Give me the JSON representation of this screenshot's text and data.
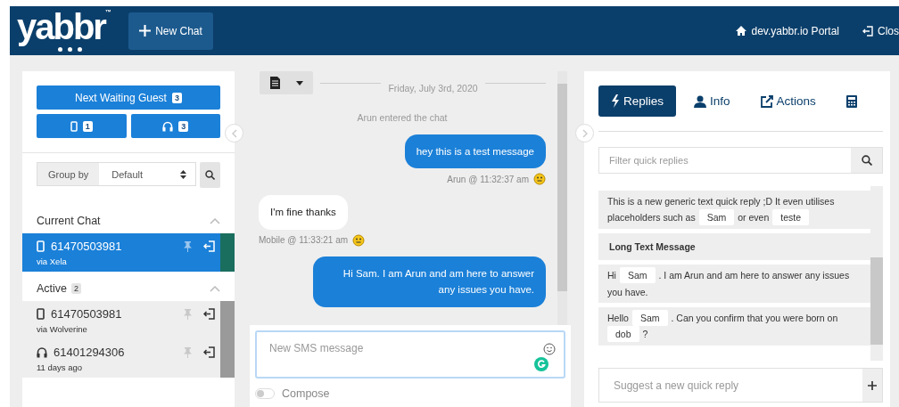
{
  "header": {
    "logo": "yabbr",
    "logo_mark": "™",
    "new_chat": "New Chat",
    "portal": "dev.yabbr.io Portal",
    "close": "Clos"
  },
  "queue": {
    "next_button": "Next Waiting Guest",
    "next_count": "3",
    "mobile_count": "1",
    "voice_count": "3"
  },
  "group_by": {
    "label": "Group by",
    "value": "Default"
  },
  "sections": [
    {
      "title": "Current Chat",
      "expanded": true,
      "items": [
        {
          "kind": "mobile",
          "number": "61470503981",
          "sub": "via Xela",
          "selected": true,
          "color": "#1a6e5e"
        }
      ]
    },
    {
      "title": "Active",
      "count": "2",
      "expanded": true,
      "items": [
        {
          "kind": "mobile",
          "number": "61470503981",
          "sub": "via Wolverine",
          "selected": false,
          "color": "#9a9a9a"
        },
        {
          "kind": "voice",
          "number": "61401294306",
          "sub": "11 days ago",
          "selected": false,
          "color": "#9a9a9a"
        }
      ]
    }
  ],
  "chat": {
    "date": "Friday, July 3rd, 2020",
    "messages": [
      {
        "kind": "system",
        "text": "Arun entered the chat"
      },
      {
        "kind": "agent",
        "text": "hey this is a test message",
        "meta": "Arun @ 11:32:37 am"
      },
      {
        "kind": "guest",
        "text": "I'm fine thanks",
        "meta": "Mobile @ 11:33:21 am"
      },
      {
        "kind": "agent",
        "text": "Hi Sam. I am Arun and am here to answer any issues you have."
      }
    ],
    "composer": {
      "placeholder": "New SMS message"
    },
    "compose": {
      "label": "Compose",
      "on": false
    }
  },
  "tabs": [
    {
      "kind": "replies",
      "label": "Replies",
      "selected": true
    },
    {
      "kind": "info",
      "label": "Info",
      "selected": false
    },
    {
      "kind": "actions",
      "label": "Actions",
      "selected": false
    },
    {
      "kind": "calc",
      "selected": false
    }
  ],
  "filter": {
    "placeholder": "Filter quick replies"
  },
  "quick_replies": [
    {
      "kind": "body",
      "parts": [
        {
          "kind": "text",
          "text": "This is a new generic text quick reply ;D It even utilises"
        },
        {
          "kind": "text",
          "text": "placeholders such as"
        },
        {
          "kind": "chip",
          "text": "Sam"
        },
        {
          "kind": "text",
          "text": "or even"
        },
        {
          "kind": "chip",
          "text": "teste"
        }
      ]
    },
    {
      "kind": "title",
      "parts": [
        {
          "kind": "text",
          "text": "Long Text Message"
        }
      ]
    },
    {
      "kind": "body",
      "parts": [
        {
          "kind": "text",
          "text": "Hi"
        },
        {
          "kind": "chip",
          "text": "Sam"
        },
        {
          "kind": "text",
          "text": ". I am Arun and am here to answer any issues"
        },
        {
          "kind": "text",
          "text": "you have."
        }
      ]
    },
    {
      "kind": "body",
      "parts": [
        {
          "kind": "text",
          "text": "Hello"
        },
        {
          "kind": "chip",
          "text": "Sam"
        },
        {
          "kind": "text",
          "text": ". Can you confirm that you were born on"
        },
        {
          "kind": "chip",
          "text": "dob"
        },
        {
          "kind": "text",
          "text": "?"
        }
      ]
    }
  ],
  "suggest": {
    "placeholder": "Suggest a new quick reply"
  }
}
